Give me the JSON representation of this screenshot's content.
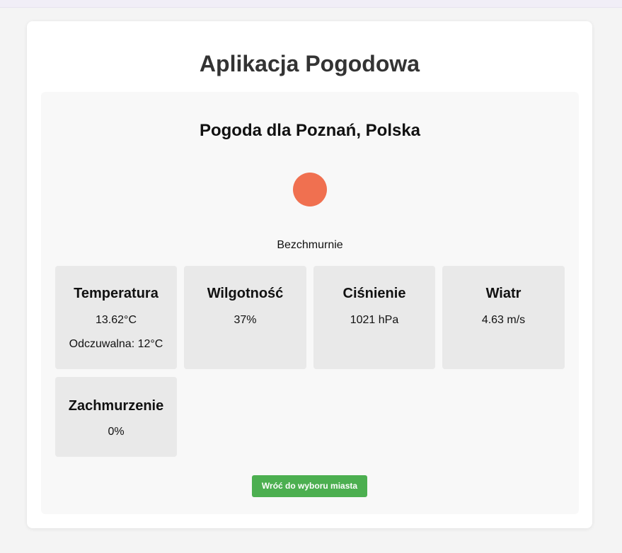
{
  "app": {
    "title": "Aplikacja Pogodowa"
  },
  "weather": {
    "location_title": "Pogoda dla Poznań, Polska",
    "icon": "sun-icon",
    "icon_color": "#f07050",
    "description": "Bezchmurnie"
  },
  "stats": [
    {
      "title": "Temperatura",
      "value": "13.62°C",
      "extra": "Odczuwalna: 12°C"
    },
    {
      "title": "Wilgotność",
      "value": "37%"
    },
    {
      "title": "Ciśnienie",
      "value": "1021 hPa"
    },
    {
      "title": "Wiatr",
      "value": "4.63 m/s"
    },
    {
      "title": "Zachmurzenie",
      "value": "0%"
    }
  ],
  "actions": {
    "back_label": "Wróć do wyboru miasta",
    "back_color": "#4caf50"
  }
}
